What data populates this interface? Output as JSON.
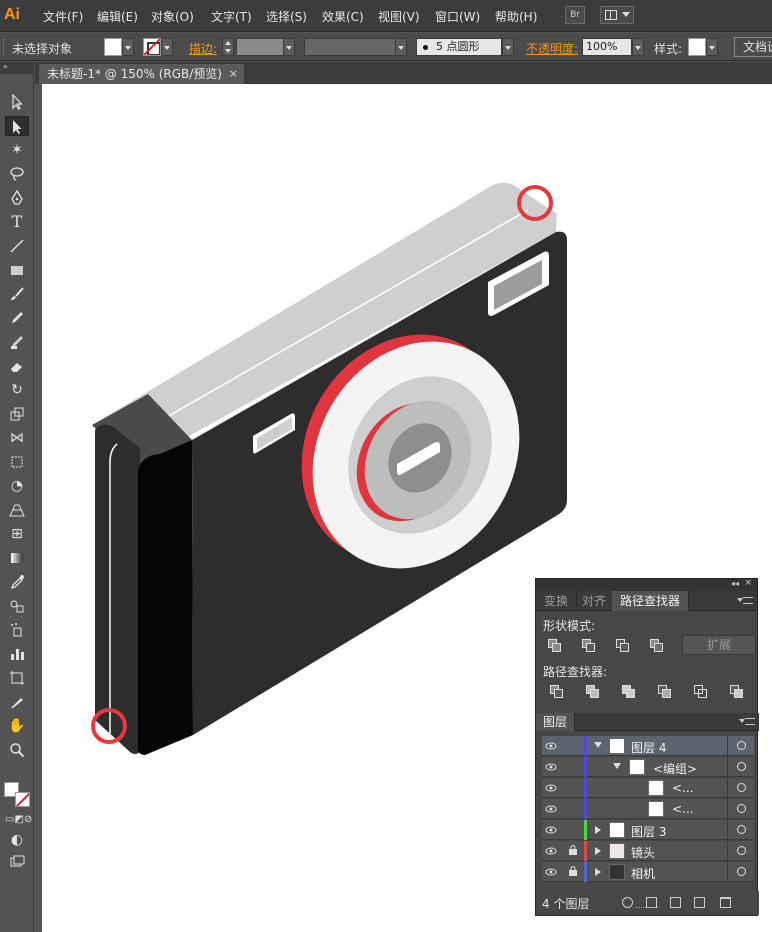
{
  "app": {
    "logo": "Ai",
    "menu": [
      "文件(F)",
      "编辑(E)",
      "对象(O)",
      "文字(T)",
      "选择(S)",
      "效果(C)",
      "视图(V)",
      "窗口(W)",
      "帮助(H)"
    ],
    "bridge_button": "Br"
  },
  "control_bar": {
    "selection_status": "未选择对象",
    "stroke_label": "描边:",
    "brush_value": "5 点圆形",
    "opacity_label": "不透明度:",
    "opacity_value": "100%",
    "style_label": "样式:",
    "doc_setup_button": "文档设"
  },
  "document": {
    "tab_title": "未标题-1* @ 150% (RGB/预览)",
    "close_glyph": "×"
  },
  "toolbox": {
    "header": "»",
    "tools": [
      "selection-tool",
      "direct-selection-tool",
      "magic-wand-tool",
      "lasso-tool",
      "pen-tool",
      "type-tool",
      "line-tool",
      "rectangle-tool",
      "paintbrush-tool",
      "pencil-tool",
      "blob-brush-tool",
      "eraser-tool",
      "rotate-tool",
      "scale-tool",
      "width-tool",
      "free-transform-tool",
      "shape-builder-tool",
      "perspective-grid-tool",
      "mesh-tool",
      "gradient-tool",
      "eyedropper-tool",
      "blend-tool",
      "symbol-sprayer-tool",
      "column-graph-tool",
      "artboard-tool",
      "slice-tool",
      "hand-tool",
      "zoom-tool"
    ],
    "active_tool": "direct-selection-tool"
  },
  "panel": {
    "collapse_glyph": "◂◂",
    "close_glyph": "×",
    "tabs": [
      "变换",
      "对齐",
      "路径查找器"
    ],
    "active_tab": "路径查找器",
    "shape_modes_label": "形状模式:",
    "expand_button": "扩展",
    "pathfinders_label": "路径查找器:"
  },
  "layers": {
    "tab": "图层",
    "rows": [
      {
        "name": "图层 4",
        "locked": false,
        "expanded": true,
        "color": "#4b4bd6",
        "selected": true
      },
      {
        "name": "<编组>",
        "locked": false,
        "expanded": true,
        "color": "#4b4bd6",
        "selected": false
      },
      {
        "name": "<...",
        "locked": false,
        "expanded": null,
        "color": "#4b4bd6",
        "selected": false
      },
      {
        "name": "<...",
        "locked": false,
        "expanded": null,
        "color": "#4b4bd6",
        "selected": false
      },
      {
        "name": "图层 3",
        "locked": false,
        "expanded": false,
        "color": "#4cd64c",
        "selected": false
      },
      {
        "name": "镜头",
        "locked": true,
        "expanded": false,
        "color": "#d64b4b",
        "selected": false
      },
      {
        "name": "相机",
        "locked": true,
        "expanded": false,
        "color": "#4b6bd6",
        "selected": false
      }
    ],
    "count_label": "4 个图层"
  },
  "colors": {
    "camera_body": "#2d2d2d",
    "camera_top": "#cfcfcf",
    "camera_side": "#050505",
    "lens_red": "#e0343f",
    "highlight_circle": "#e8383f"
  }
}
